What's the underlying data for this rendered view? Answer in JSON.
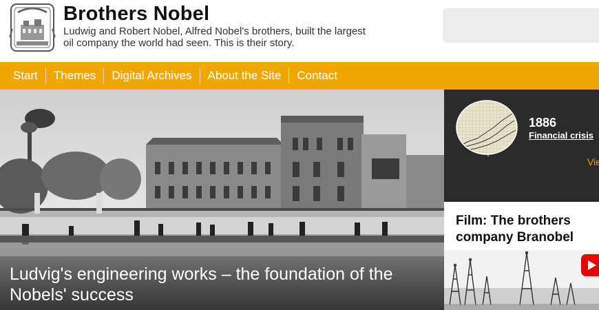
{
  "site": {
    "title": "Brothers Nobel",
    "tagline": "Ludwig and Robert Nobel, Alfred Nobel's brothers, built the largest oil company the world had seen. This is their story."
  },
  "nav": {
    "items": [
      "Start",
      "Themes",
      "Digital Archives",
      "About the Site",
      "Contact"
    ]
  },
  "hero": {
    "title": "Ludvig's engineering works – the foundation of the Nobels' success"
  },
  "timeline": {
    "year": "1886",
    "event": "Financial crisis",
    "link": "Vie"
  },
  "film": {
    "title_line1": "Film: The brothers",
    "title_line2": "company Branobel"
  },
  "colors": {
    "accent": "#f0a800",
    "dark_panel": "#2b2b2b"
  },
  "icons": {
    "logo": "nobel-crest",
    "play": "play-icon"
  }
}
